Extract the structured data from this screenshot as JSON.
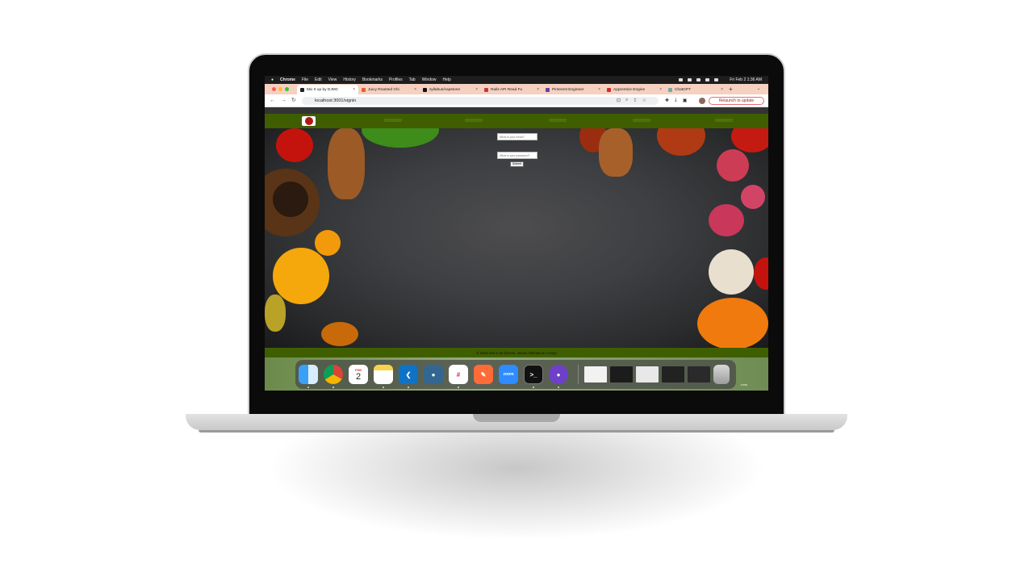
{
  "browser": {
    "menubar": {
      "apple": "",
      "app": "Chrome",
      "items": [
        "File",
        "Edit",
        "View",
        "History",
        "Bookmarks",
        "Profiles",
        "Tab",
        "Window",
        "Help"
      ],
      "clock": "Fri Feb 2  1:36 AM"
    },
    "tabs": [
      {
        "title": "Mix It up by DJMC",
        "color": "#222222"
      },
      {
        "title": "Juicy Roasted Chi",
        "color": "#e8602c"
      },
      {
        "title": "syllabus/capstone",
        "color": "#111111"
      },
      {
        "title": "Rails API Read Fu",
        "color": "#c23a3a"
      },
      {
        "title": "Pinterest Engineer",
        "color": "#6b3fa0"
      },
      {
        "title": "Apprentice Engine",
        "color": "#d42a2a"
      },
      {
        "title": "ChatGPT",
        "color": "#74aa9c"
      }
    ],
    "url": "localhost:3001/signin",
    "relaunch": "Relaunch to update"
  },
  "site": {
    "login": {
      "email_placeholder": "What is your email?",
      "password_placeholder": "What is your password?",
      "submit": "Submit"
    },
    "footer": "© 2024 Mix it Up (Derek, Jacob, Michael & Corey)"
  },
  "dock": {
    "calendar_month": "FEB",
    "calendar_day": "2",
    "zoom_label": "zoom",
    "edge_label": "t.md"
  }
}
